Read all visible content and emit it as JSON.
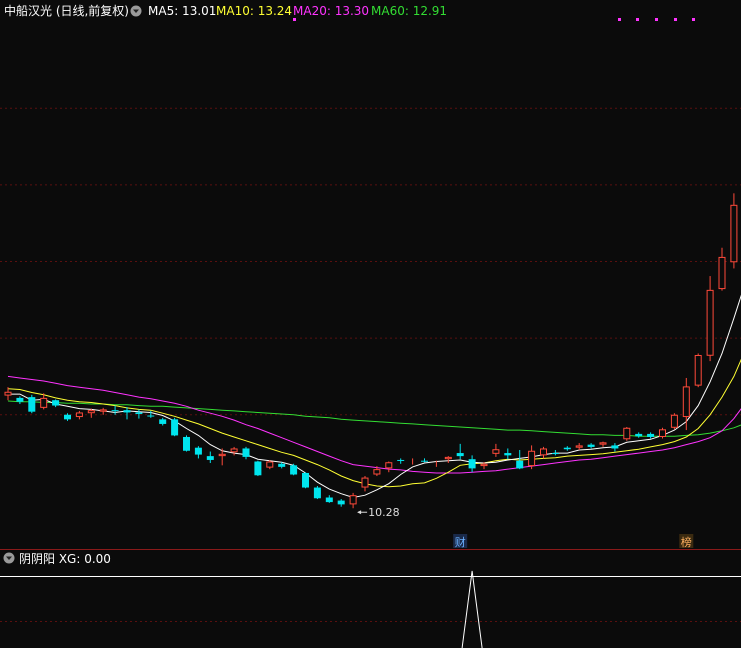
{
  "header": {
    "title": "中船汉光 (日线,前复权)",
    "ma5_label": "MA5: 13.01",
    "ma10_label": "MA10: 13.24",
    "ma20_label": "MA20: 13.30",
    "ma60_label": "MA60: 12.91"
  },
  "indicator": {
    "label": "阴阴阳 XG: 0.00",
    "signal_index": 39
  },
  "markers": {
    "low_label": "10.28",
    "low_index": 29,
    "cai_label": "财",
    "cai_index": 38,
    "bang_label": "榜",
    "bang_index": 57
  },
  "colors": {
    "bg": "#0b0b0b",
    "up": "#ff4a3a",
    "down": "#00e5ee",
    "flat": "#ffffff",
    "ma5": "#ffffff",
    "ma10": "#ffff33",
    "ma20": "#ff33ff",
    "ma60": "#33dd33",
    "grid": "#5a1010",
    "title": "#ffffff",
    "dot": "#ff33ff"
  },
  "chart_data": {
    "type": "candlestick",
    "ylim": [
      9.8,
      16.6
    ],
    "ohlc": [
      [
        11.75,
        11.86,
        11.69,
        11.8
      ],
      [
        11.72,
        11.74,
        11.64,
        11.67
      ],
      [
        11.73,
        11.76,
        11.52,
        11.54
      ],
      [
        11.59,
        11.78,
        11.57,
        11.72
      ],
      [
        11.69,
        11.7,
        11.6,
        11.62
      ],
      [
        11.5,
        11.52,
        11.42,
        11.44
      ],
      [
        11.47,
        11.55,
        11.44,
        11.53
      ],
      [
        11.52,
        11.58,
        11.46,
        11.56
      ],
      [
        11.54,
        11.59,
        11.5,
        11.57
      ],
      [
        11.56,
        11.62,
        11.5,
        11.55
      ],
      [
        11.56,
        11.6,
        11.44,
        11.53
      ],
      [
        11.53,
        11.57,
        11.45,
        11.51
      ],
      [
        11.49,
        11.55,
        11.46,
        11.48
      ],
      [
        11.44,
        11.46,
        11.36,
        11.38
      ],
      [
        11.44,
        11.46,
        11.22,
        11.23
      ],
      [
        11.21,
        11.23,
        11.02,
        11.03
      ],
      [
        11.07,
        11.09,
        10.93,
        10.98
      ],
      [
        10.96,
        11.02,
        10.87,
        10.91
      ],
      [
        10.96,
        11.06,
        10.84,
        10.99
      ],
      [
        11.01,
        11.08,
        10.97,
        11.06
      ],
      [
        11.06,
        11.08,
        10.92,
        10.95
      ],
      [
        10.89,
        10.9,
        10.7,
        10.71
      ],
      [
        10.81,
        10.91,
        10.79,
        10.89
      ],
      [
        10.86,
        10.88,
        10.8,
        10.82
      ],
      [
        10.84,
        10.86,
        10.71,
        10.72
      ],
      [
        10.74,
        10.75,
        10.54,
        10.55
      ],
      [
        10.55,
        10.57,
        10.4,
        10.41
      ],
      [
        10.42,
        10.45,
        10.35,
        10.36
      ],
      [
        10.38,
        10.4,
        10.3,
        10.33
      ],
      [
        10.33,
        10.48,
        10.28,
        10.45
      ],
      [
        10.55,
        10.7,
        10.5,
        10.68
      ],
      [
        10.72,
        10.83,
        10.7,
        10.79
      ],
      [
        10.8,
        10.89,
        10.75,
        10.88
      ],
      [
        10.91,
        10.93,
        10.86,
        10.9
      ],
      [
        10.9,
        10.93,
        10.85,
        10.91
      ],
      [
        10.9,
        10.93,
        10.88,
        10.89
      ],
      [
        10.86,
        10.9,
        10.82,
        10.87
      ],
      [
        10.92,
        10.96,
        10.87,
        10.95
      ],
      [
        11.0,
        11.12,
        10.92,
        10.96
      ],
      [
        10.92,
        10.97,
        10.75,
        10.8
      ],
      [
        10.83,
        10.88,
        10.79,
        10.86
      ],
      [
        10.99,
        11.12,
        10.95,
        11.05
      ],
      [
        11.0,
        11.06,
        10.92,
        10.97
      ],
      [
        10.9,
        11.04,
        10.79,
        10.8
      ],
      [
        10.83,
        11.1,
        10.79,
        11.03
      ],
      [
        10.97,
        11.08,
        10.93,
        11.06
      ],
      [
        11.0,
        11.04,
        10.97,
        10.99
      ],
      [
        11.07,
        11.09,
        11.03,
        11.05
      ],
      [
        11.07,
        11.13,
        11.04,
        11.1
      ],
      [
        11.11,
        11.13,
        11.06,
        11.08
      ],
      [
        11.11,
        11.15,
        11.08,
        11.14
      ],
      [
        11.1,
        11.13,
        11.02,
        11.06
      ],
      [
        11.18,
        11.34,
        11.16,
        11.33
      ],
      [
        11.25,
        11.27,
        11.2,
        11.22
      ],
      [
        11.25,
        11.27,
        11.19,
        11.21
      ],
      [
        11.21,
        11.33,
        11.19,
        11.31
      ],
      [
        11.33,
        11.52,
        11.31,
        11.5
      ],
      [
        11.47,
        11.98,
        11.3,
        11.87
      ],
      [
        11.88,
        12.3,
        11.86,
        12.28
      ],
      [
        12.27,
        13.31,
        12.2,
        13.13
      ],
      [
        13.14,
        13.68,
        13.12,
        13.56
      ],
      [
        13.49,
        14.39,
        13.41,
        14.24
      ],
      [
        14.29,
        15.47,
        14.25,
        15.36
      ],
      [
        15.29,
        15.44,
        15.17,
        15.19
      ],
      [
        15.34,
        16.47,
        15.34,
        15.97
      ],
      [
        15.9,
        15.99,
        15.78,
        15.8
      ]
    ],
    "ma5": [
      11.77,
      11.77,
      11.69,
      11.7,
      11.64,
      11.61,
      11.58,
      11.57,
      11.55,
      11.53,
      11.55,
      11.54,
      11.53,
      11.49,
      11.42,
      11.32,
      11.23,
      11.11,
      11.03,
      11.0,
      10.98,
      10.92,
      10.9,
      10.88,
      10.84,
      10.74,
      10.62,
      10.53,
      10.47,
      10.42,
      10.45,
      10.52,
      10.6,
      10.72,
      10.82,
      10.87,
      10.89,
      10.9,
      10.91,
      10.88,
      10.87,
      10.88,
      10.91,
      10.93,
      10.95,
      10.98,
      11.0,
      11.0,
      11.04,
      11.05,
      11.07,
      11.08,
      11.14,
      11.16,
      11.18,
      11.23,
      11.3,
      11.41,
      11.62,
      11.93,
      12.3,
      12.76,
      13.24,
      13.78,
      14.35,
      14.65
    ],
    "ma10": [
      11.84,
      11.83,
      11.79,
      11.76,
      11.72,
      11.69,
      11.67,
      11.66,
      11.64,
      11.62,
      11.59,
      11.57,
      11.56,
      11.52,
      11.48,
      11.43,
      11.38,
      11.32,
      11.26,
      11.21,
      11.16,
      11.11,
      11.06,
      11.01,
      10.97,
      10.91,
      10.85,
      10.78,
      10.7,
      10.64,
      10.6,
      10.57,
      10.56,
      10.57,
      10.6,
      10.61,
      10.67,
      10.75,
      10.84,
      10.86,
      10.87,
      10.9,
      10.92,
      10.91,
      10.92,
      10.93,
      10.94,
      10.96,
      10.97,
      10.98,
      10.99,
      11.01,
      11.03,
      11.05,
      11.08,
      11.11,
      11.15,
      11.21,
      11.32,
      11.5,
      11.73,
      12.0,
      12.36,
      12.73,
      13.08,
      13.36
    ],
    "ma20": [
      12.0,
      11.98,
      11.96,
      11.94,
      11.91,
      11.88,
      11.86,
      11.84,
      11.82,
      11.79,
      11.76,
      11.73,
      11.71,
      11.68,
      11.65,
      11.61,
      11.56,
      11.52,
      11.48,
      11.43,
      11.37,
      11.32,
      11.26,
      11.2,
      11.14,
      11.08,
      11.02,
      10.96,
      10.9,
      10.85,
      10.83,
      10.81,
      10.79,
      10.78,
      10.76,
      10.75,
      10.74,
      10.74,
      10.74,
      10.75,
      10.76,
      10.77,
      10.79,
      10.81,
      10.83,
      10.85,
      10.87,
      10.89,
      10.91,
      10.92,
      10.94,
      10.96,
      10.98,
      11.0,
      11.02,
      11.04,
      11.07,
      11.11,
      11.15,
      11.2,
      11.29,
      11.45,
      11.66,
      11.9,
      12.15,
      12.38
    ],
    "ma60": [
      11.68,
      11.67,
      11.67,
      11.66,
      11.66,
      11.65,
      11.65,
      11.64,
      11.64,
      11.63,
      11.63,
      11.62,
      11.61,
      11.61,
      11.6,
      11.59,
      11.58,
      11.57,
      11.56,
      11.55,
      11.54,
      11.53,
      11.52,
      11.51,
      11.5,
      11.48,
      11.47,
      11.46,
      11.44,
      11.43,
      11.42,
      11.41,
      11.4,
      11.39,
      11.38,
      11.37,
      11.36,
      11.35,
      11.34,
      11.33,
      11.32,
      11.31,
      11.3,
      11.3,
      11.29,
      11.28,
      11.27,
      11.26,
      11.25,
      11.24,
      11.24,
      11.23,
      11.23,
      11.22,
      11.22,
      11.22,
      11.22,
      11.23,
      11.24,
      11.26,
      11.29,
      11.33,
      11.39,
      11.46,
      11.55,
      11.63
    ]
  }
}
